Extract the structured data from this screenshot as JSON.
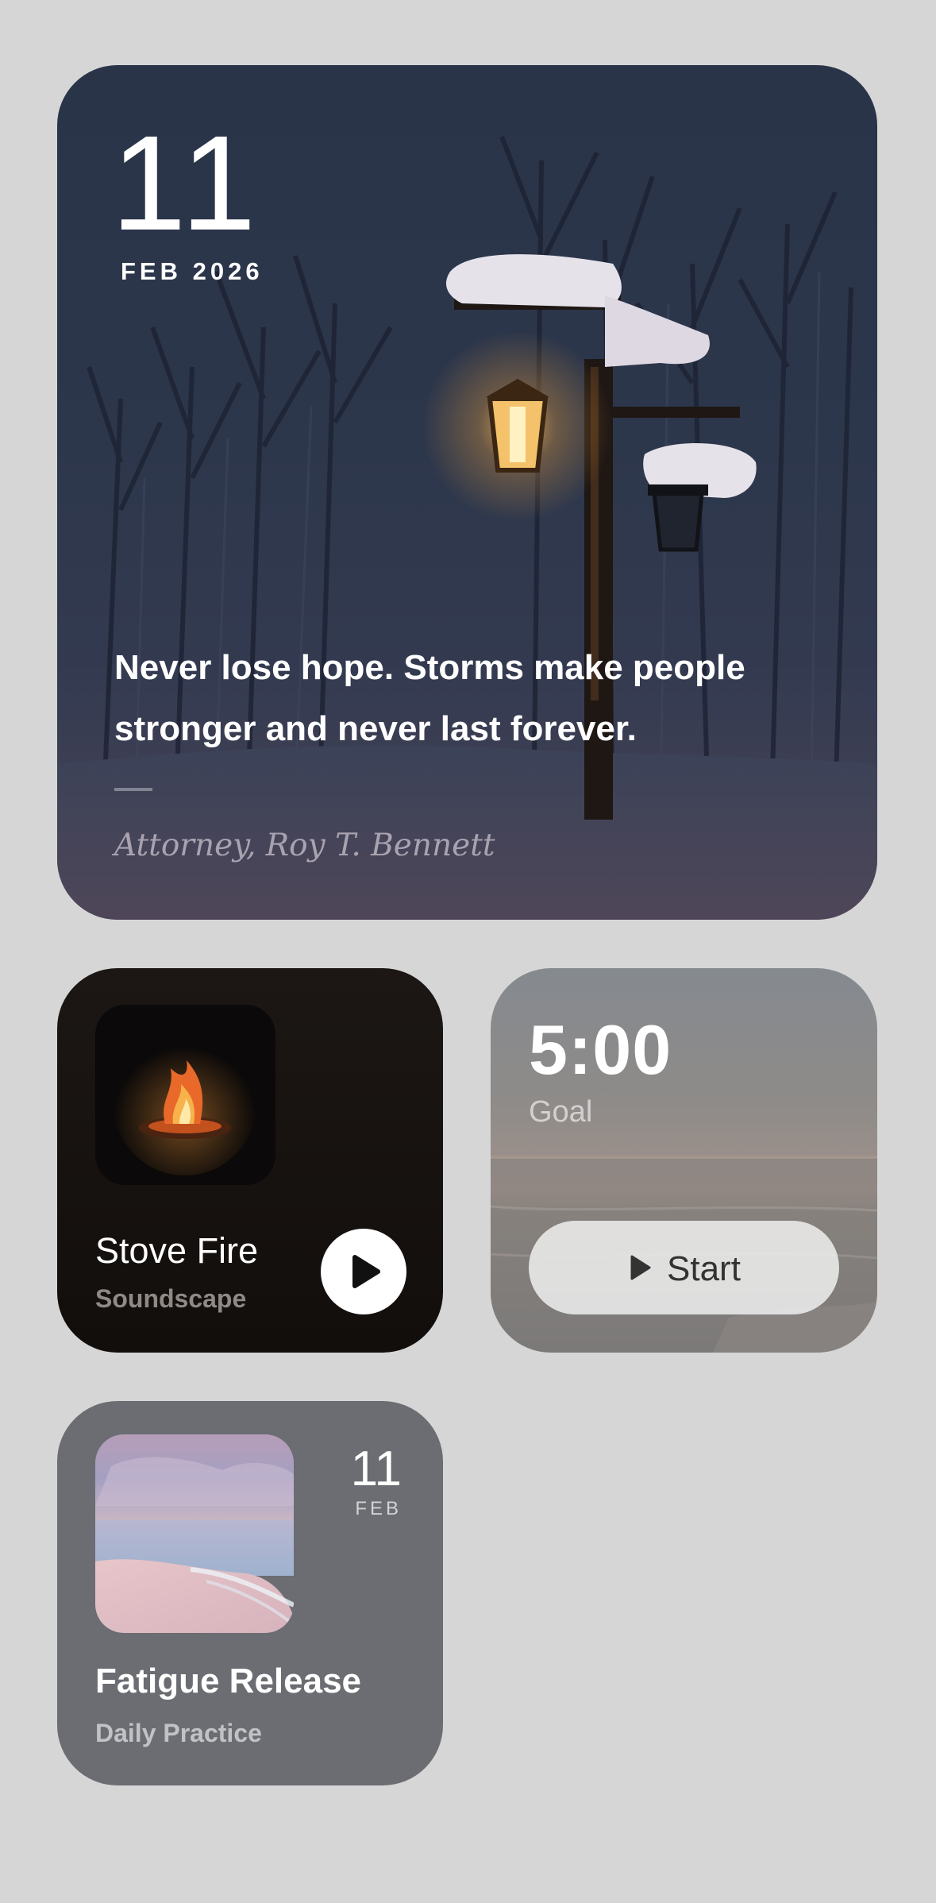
{
  "quote_widget": {
    "day": "11",
    "month_year": "FEB 2026",
    "quote": "Never lose hope. Storms make people stronger and never last forever.",
    "author": "Attorney, Roy T. Bennett"
  },
  "soundscape_widget": {
    "title": "Stove Fire",
    "subtitle": "Soundscape",
    "play_icon": "play-icon"
  },
  "timer_widget": {
    "value": "5:00",
    "label": "Goal",
    "start_label": "Start"
  },
  "practice_widget": {
    "day": "11",
    "month": "FEB",
    "title": "Fatigue Release",
    "subtitle": "Daily Practice"
  },
  "colors": {
    "page_background": "#d6d6d6",
    "soundscape_background": "#120e0c",
    "practice_background": "#6b6d72"
  }
}
